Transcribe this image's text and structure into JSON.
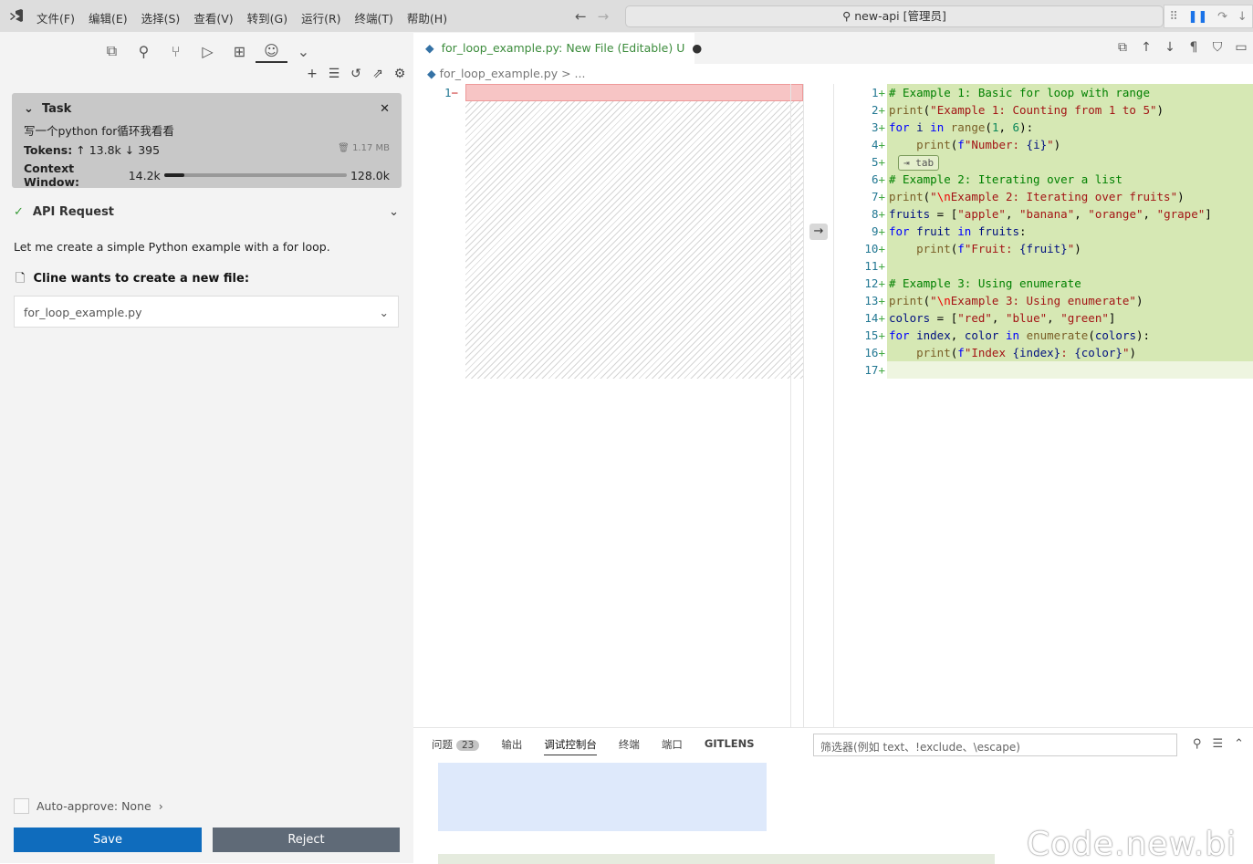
{
  "titlebar": {
    "menu": [
      "文件(F)",
      "编辑(E)",
      "选择(S)",
      "查看(V)",
      "转到(G)",
      "运行(R)",
      "终端(T)",
      "帮助(H)"
    ],
    "search": "new-api [管理员]"
  },
  "task": {
    "label": "Task",
    "text": "写一个python for循环我看看",
    "tokens_label": "Tokens:",
    "tokens_up": "13.8k",
    "tokens_down": "395",
    "size": "1.17 MB",
    "context_label": "Context Window:",
    "context_used": "14.2k",
    "context_max": "128.0k",
    "context_fraction": 0.11
  },
  "api": {
    "label": "API Request"
  },
  "message": "Let me create a simple Python example with a for loop.",
  "newfile": {
    "label": "Cline wants to create a new file:",
    "filename": "for_loop_example.py"
  },
  "auto_approve": "Auto-approve: None",
  "buttons": {
    "save": "Save",
    "reject": "Reject"
  },
  "tab": {
    "title": "for_loop_example.py: New File (Editable)",
    "status": "U"
  },
  "breadcrumb": "for_loop_example.py > ...",
  "left_gutter": "1",
  "code_lines": [
    "# Example 1: Basic for loop with range",
    "print(\"Example 1: Counting from 1 to 5\")",
    "for i in range(1, 6):",
    "    print(f\"Number: {i}\")",
    "",
    "# Example 2: Iterating over a list",
    "print(\"\\nExample 2: Iterating over fruits\")",
    "fruits = [\"apple\", \"banana\", \"orange\", \"grape\"]",
    "for fruit in fruits:",
    "    print(f\"Fruit: {fruit}\")",
    "",
    "# Example 3: Using enumerate",
    "print(\"\\nExample 3: Using enumerate\")",
    "colors = [\"red\", \"blue\", \"green\"]",
    "for index, color in enumerate(colors):",
    "    print(f\"Index {index}: {color}\")",
    ""
  ],
  "tab_hint": "⇥ tab",
  "panel": {
    "tabs": [
      "问题",
      "输出",
      "调试控制台",
      "终端",
      "端口",
      "GITLENS"
    ],
    "problem_count": "23",
    "filter_placeholder": "筛选器(例如 text、!exclude、\\escape)"
  },
  "watermark": "Code.new.bi"
}
